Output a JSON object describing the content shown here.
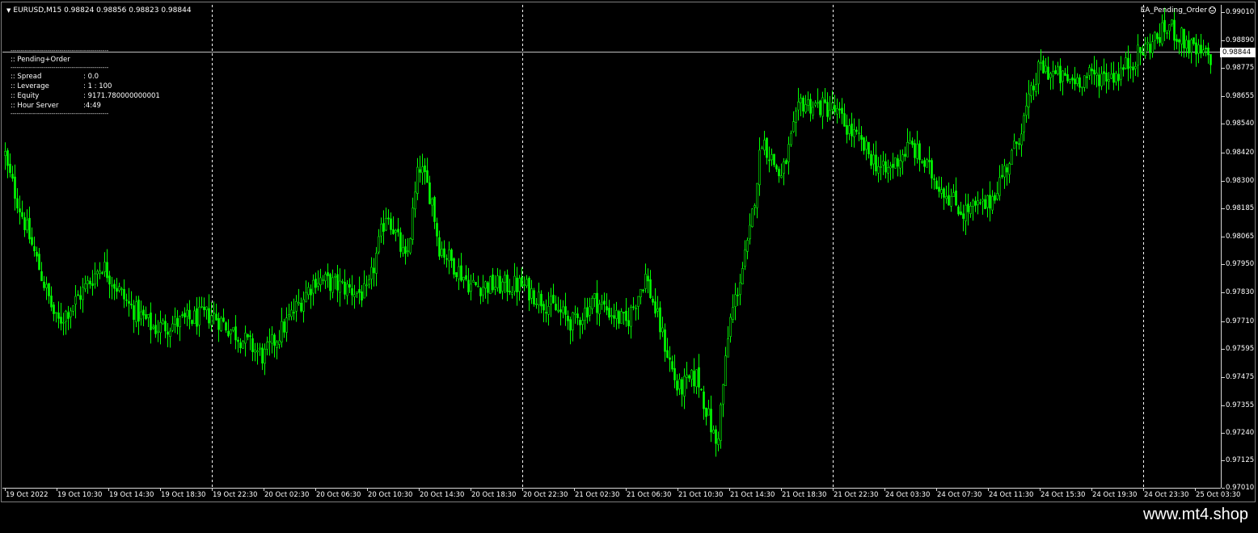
{
  "header": {
    "symbol_line": "EURUSD,M15  0.98824 0.98856 0.98823 0.98844",
    "ea_name": "EA_Pending_Order",
    "ea_icon": "smiley-icon",
    "dropdown_icon": "triangle-down-icon"
  },
  "info_panel": {
    "separator": "------------------------------------------------",
    "title": ":: Pending+Order",
    "rows": [
      {
        "key": ":: Spread",
        "value": ": 0.0"
      },
      {
        "key": ":: Leverage",
        "value": ": 1 : 100"
      },
      {
        "key": ":: Equity",
        "value": ": 9171.780000000001"
      },
      {
        "key": ":: Hour Server",
        "value": ":4:49"
      }
    ]
  },
  "bid_label": "0.98844",
  "watermark": "www.mt4.shop",
  "colors": {
    "background": "#000000",
    "candles": "#00ff00",
    "grid": "#ffffff",
    "bid_line": "#c0c0c0"
  },
  "chart_data": {
    "type": "candlestick",
    "symbol": "EURUSD",
    "timeframe": "M15",
    "ylim": [
      0.9701,
      0.9904
    ],
    "price_ticks": [
      "0.99010",
      "0.98890",
      "0.98775",
      "0.98655",
      "0.98540",
      "0.98420",
      "0.98300",
      "0.98185",
      "0.98065",
      "0.97950",
      "0.97830",
      "0.97710",
      "0.97595",
      "0.97475",
      "0.97355",
      "0.97240",
      "0.97125",
      "0.97010"
    ],
    "time_ticks": [
      "19 Oct 2022",
      "19 Oct 10:30",
      "19 Oct 14:30",
      "19 Oct 18:30",
      "19 Oct 22:30",
      "20 Oct 02:30",
      "20 Oct 06:30",
      "20 Oct 10:30",
      "20 Oct 14:30",
      "20 Oct 18:30",
      "20 Oct 22:30",
      "21 Oct 02:30",
      "21 Oct 06:30",
      "21 Oct 10:30",
      "21 Oct 14:30",
      "21 Oct 18:30",
      "21 Oct 22:30",
      "24 Oct 03:30",
      "24 Oct 07:30",
      "24 Oct 11:30",
      "24 Oct 15:30",
      "24 Oct 19:30",
      "24 Oct 23:30",
      "25 Oct 03:30"
    ],
    "period_separators": [
      "19 Oct 22:30",
      "20 Oct 22:30",
      "21 Oct 22:30",
      "24 Oct 23:30"
    ],
    "bid": 0.98844,
    "last_bar": {
      "open": 0.98824,
      "high": 0.98856,
      "low": 0.98823,
      "close": 0.98844
    },
    "path": [
      {
        "t": "19 Oct 2022",
        "price": 0.9841
      },
      {
        "t": "19 Oct 06:00",
        "price": 0.9838
      },
      {
        "t": "19 Oct 10:00",
        "price": 0.977
      },
      {
        "t": "19 Oct 12:00",
        "price": 0.978
      },
      {
        "t": "19 Oct 14:00",
        "price": 0.9795
      },
      {
        "t": "19 Oct 16:00",
        "price": 0.9778
      },
      {
        "t": "19 Oct 18:00",
        "price": 0.9768
      },
      {
        "t": "19 Oct 22:30",
        "price": 0.9774
      },
      {
        "t": "20 Oct 02:30",
        "price": 0.9756
      },
      {
        "t": "20 Oct 06:30",
        "price": 0.9789
      },
      {
        "t": "20 Oct 10:30",
        "price": 0.9782
      },
      {
        "t": "20 Oct 12:00",
        "price": 0.9818
      },
      {
        "t": "20 Oct 13:30",
        "price": 0.9795
      },
      {
        "t": "20 Oct 14:30",
        "price": 0.9837
      },
      {
        "t": "20 Oct 15:30",
        "price": 0.9822
      },
      {
        "t": "20 Oct 16:00",
        "price": 0.9803
      },
      {
        "t": "20 Oct 18:30",
        "price": 0.9786
      },
      {
        "t": "20 Oct 22:30",
        "price": 0.9786
      },
      {
        "t": "21 Oct 02:30",
        "price": 0.977
      },
      {
        "t": "21 Oct 04:00",
        "price": 0.978
      },
      {
        "t": "21 Oct 06:30",
        "price": 0.977
      },
      {
        "t": "21 Oct 08:00",
        "price": 0.979
      },
      {
        "t": "21 Oct 10:30",
        "price": 0.9742
      },
      {
        "t": "21 Oct 12:00",
        "price": 0.9748
      },
      {
        "t": "21 Oct 13:30",
        "price": 0.9718
      },
      {
        "t": "21 Oct 14:30",
        "price": 0.977
      },
      {
        "t": "21 Oct 16:00",
        "price": 0.9805
      },
      {
        "t": "21 Oct 17:00",
        "price": 0.9848
      },
      {
        "t": "21 Oct 18:30",
        "price": 0.9831
      },
      {
        "t": "21 Oct 20:00",
        "price": 0.9863
      },
      {
        "t": "21 Oct 22:30",
        "price": 0.986
      },
      {
        "t": "24 Oct 00:00",
        "price": 0.985
      },
      {
        "t": "24 Oct 03:30",
        "price": 0.9833
      },
      {
        "t": "24 Oct 05:30",
        "price": 0.9845
      },
      {
        "t": "24 Oct 07:30",
        "price": 0.983
      },
      {
        "t": "24 Oct 09:30",
        "price": 0.9817
      },
      {
        "t": "24 Oct 11:30",
        "price": 0.982
      },
      {
        "t": "24 Oct 13:30",
        "price": 0.9843
      },
      {
        "t": "24 Oct 15:30",
        "price": 0.9878
      },
      {
        "t": "24 Oct 17:30",
        "price": 0.9872
      },
      {
        "t": "24 Oct 19:30",
        "price": 0.9874
      },
      {
        "t": "24 Oct 21:30",
        "price": 0.9875
      },
      {
        "t": "24 Oct 23:30",
        "price": 0.9885
      },
      {
        "t": "25 Oct 01:30",
        "price": 0.9895
      },
      {
        "t": "25 Oct 03:30",
        "price": 0.9884
      }
    ]
  }
}
